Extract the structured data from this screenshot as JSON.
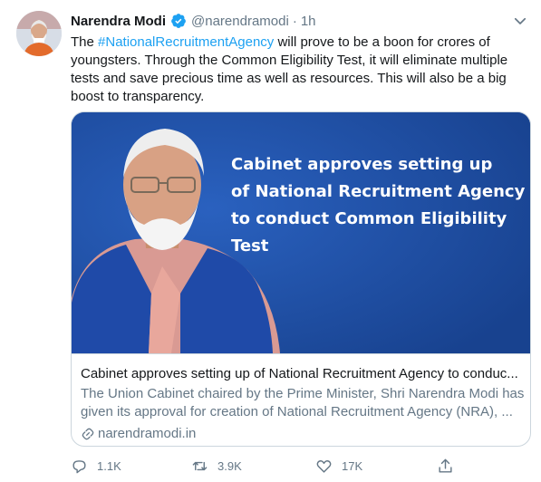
{
  "author": {
    "name": "Narendra Modi",
    "handle": "@narendramodi",
    "separator": "·",
    "time": "1h"
  },
  "tweet": {
    "hashtag": "#NationalRecruitmentAgency",
    "text_before": "The ",
    "text_after": " will prove to be a boon for crores of youngsters. Through the Common Eligibility Test, it will eliminate multiple tests and save precious time as well as resources. This will also be a big boost to transparency."
  },
  "card": {
    "image_headline_line1": "Cabinet approves setting up",
    "image_headline_line2": "of National Recruitment Agency",
    "image_headline_line3": "to conduct Common Eligibility Test",
    "title": "Cabinet approves setting up of National Recruitment Agency to conduc...",
    "description": "The Union Cabinet chaired by the Prime Minister, Shri Narendra Modi has given its approval for creation of National Recruitment Agency (NRA), ...",
    "domain": "narendramodi.in"
  },
  "actions": {
    "reply_count": "1.1K",
    "retweet_count": "3.9K",
    "like_count": "17K"
  },
  "colors": {
    "accent": "#1da1f2",
    "secondary_text": "#657786",
    "card_image_bg": "#1f4ea3"
  },
  "icons": [
    "verified-badge-icon",
    "chevron-down-icon",
    "link-icon",
    "reply-icon",
    "retweet-icon",
    "like-icon",
    "share-icon"
  ]
}
